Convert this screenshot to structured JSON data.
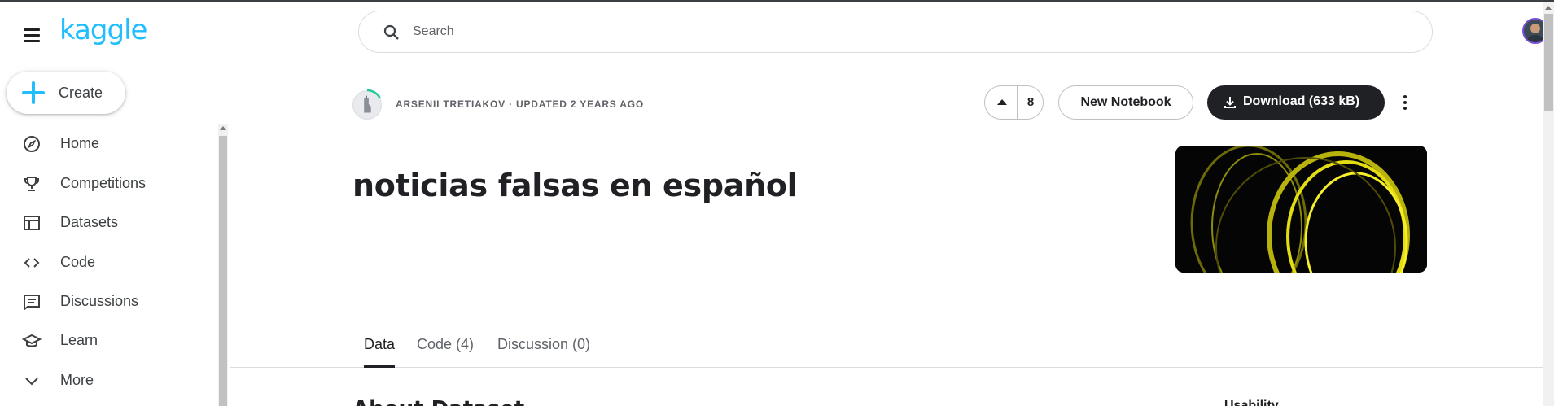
{
  "app": {
    "logo": "kaggle"
  },
  "sidebar": {
    "create_label": "Create",
    "items": [
      {
        "label": "Home",
        "icon": "compass-icon"
      },
      {
        "label": "Competitions",
        "icon": "trophy-icon"
      },
      {
        "label": "Datasets",
        "icon": "table-icon"
      },
      {
        "label": "Code",
        "icon": "code-icon"
      },
      {
        "label": "Discussions",
        "icon": "comment-icon"
      },
      {
        "label": "Learn",
        "icon": "school-icon"
      },
      {
        "label": "More",
        "icon": "chevron-down-icon"
      }
    ]
  },
  "search": {
    "placeholder": "Search",
    "value": ""
  },
  "dataset": {
    "author": "ARSENII TRETIAKOV",
    "updated": "· UPDATED 2 YEARS AGO",
    "upvotes": "8",
    "new_notebook_label": "New Notebook",
    "download_label": "Download (633 kB)",
    "title": "noticias falsas en español"
  },
  "tabs": [
    {
      "label": "Data",
      "active": true
    },
    {
      "label": "Code (4)",
      "active": false
    },
    {
      "label": "Discussion (0)",
      "active": false
    }
  ],
  "content": {
    "about_heading": "About Dataset",
    "usability_label": "Usability"
  },
  "colors": {
    "brand": "#20beff",
    "dark_button": "#202124",
    "avatar_ring": "#7b4fd8",
    "progress_ring": "#20c997"
  }
}
